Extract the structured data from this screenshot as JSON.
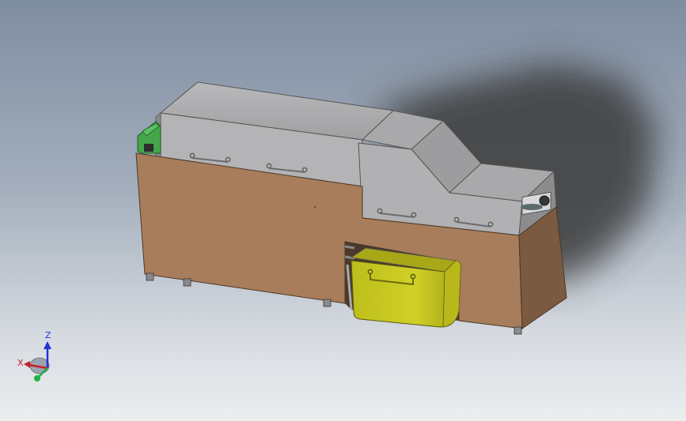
{
  "viewport": {
    "background_top": "#7f8da1",
    "background_bottom": "#eceef0"
  },
  "model": {
    "colors": {
      "housing": "#b1b1b3",
      "housing_top": "#a6a6a8",
      "cabinet_front": "#a87d5b",
      "cabinet_side": "#7a5a41",
      "bin": "#cccc1f",
      "motor": "#45a64c"
    }
  },
  "triad": {
    "z_label": "Z",
    "x_label": "X",
    "z_color": "#1c35d8",
    "x_color": "#c8202a",
    "y_color": "#20b040"
  }
}
